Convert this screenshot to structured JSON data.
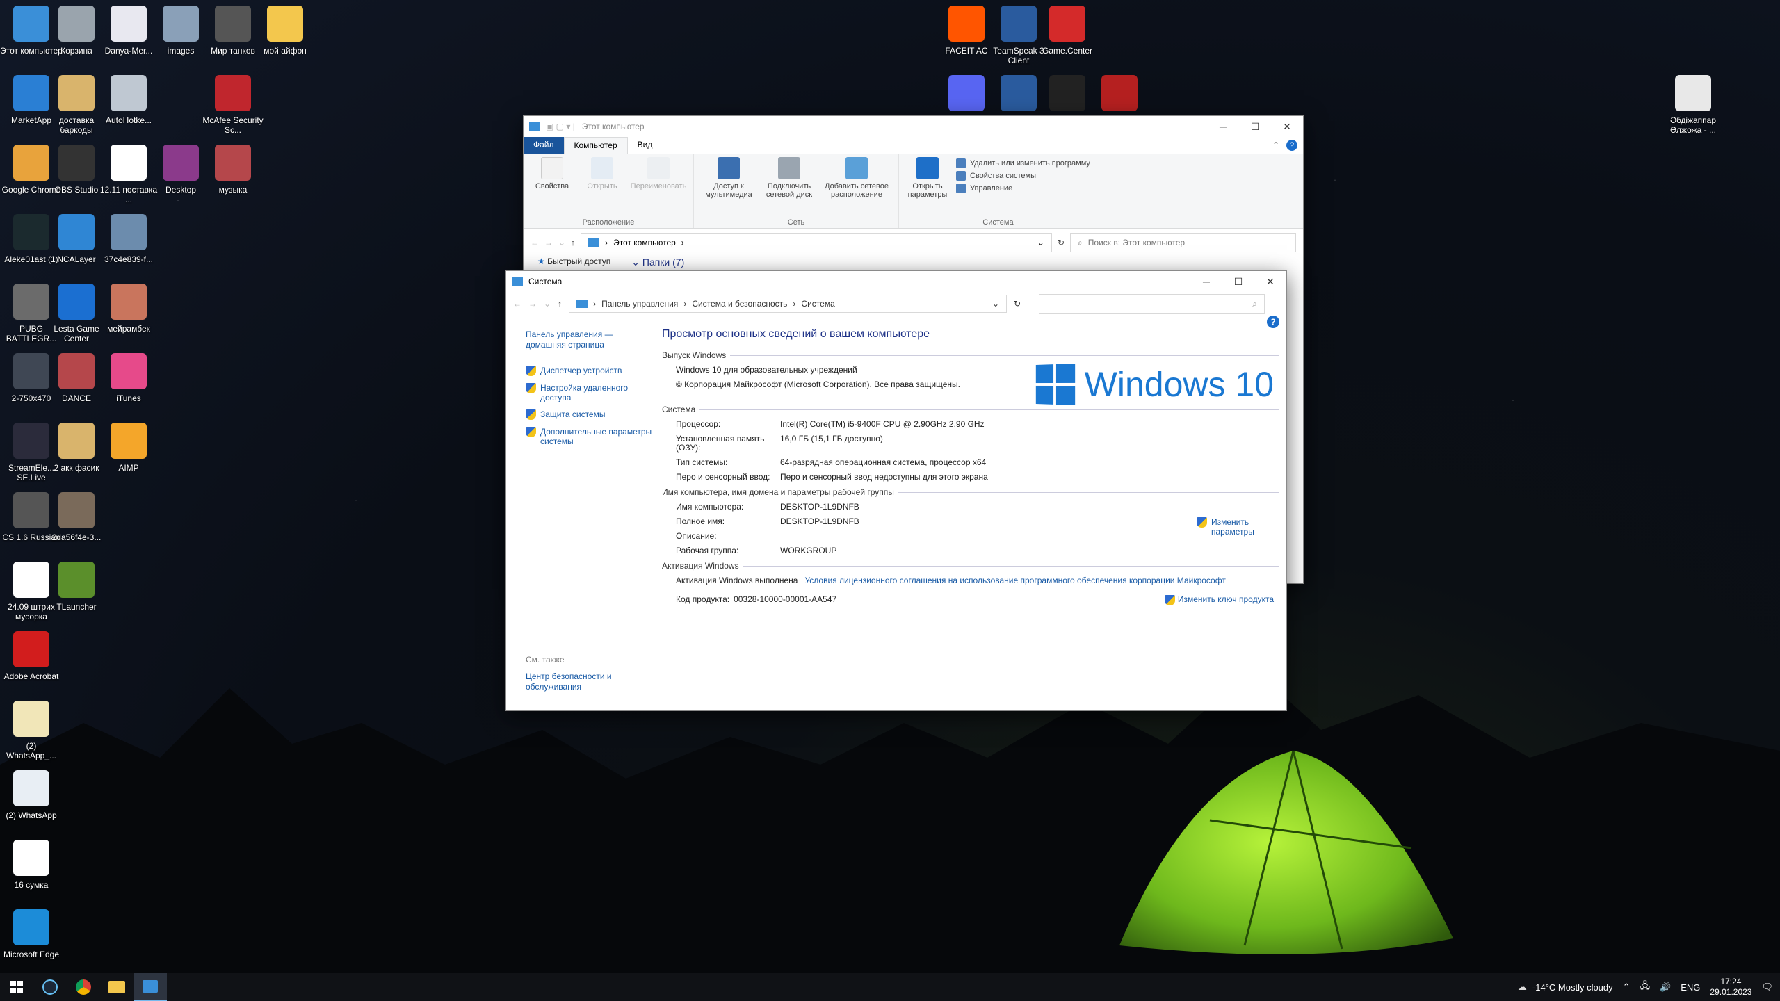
{
  "desktop_icons": [
    {
      "label": "Этот компьютер",
      "icon": "this-pc-icon",
      "color": "#3a8fd8"
    },
    {
      "label": "Корзина",
      "icon": "recycle-bin-icon",
      "color": "#9aa4ad"
    },
    {
      "label": "Danya-Mer...",
      "icon": "word-doc-icon",
      "color": "#e8e8f0"
    },
    {
      "label": "images",
      "icon": "image-icon",
      "color": "#8aa0b8"
    },
    {
      "label": "Мир танков",
      "icon": "tank-game-icon",
      "color": "#555"
    },
    {
      "label": "мой айфон",
      "icon": "folder-icon",
      "color": "#f3c74d"
    },
    {
      "label": "MarketApp",
      "icon": "marketapp-icon",
      "color": "#2a7fd4"
    },
    {
      "label": "доставка баркоды",
      "icon": "archive-icon",
      "color": "#d9b46c"
    },
    {
      "label": "AutoHotke...",
      "icon": "script-icon",
      "color": "#bfc8d2"
    },
    {
      "label": "McAfee Security Sc...",
      "icon": "mcafee-icon",
      "color": "#c0262d"
    },
    {
      "label": "Google Chrome",
      "icon": "chrome-icon",
      "color": "#e8a33c"
    },
    {
      "label": "OBS Studio",
      "icon": "obs-icon",
      "color": "#333"
    },
    {
      "label": "12.11 поставка ...",
      "icon": "pdf-icon",
      "color": "#fff"
    },
    {
      "label": "Desktop",
      "icon": "winrar-icon",
      "color": "#8b3a8b"
    },
    {
      "label": "музыка",
      "icon": "archive-icon",
      "color": "#b5474b"
    },
    {
      "label": "Aleke01ast (1)",
      "icon": "file-icon",
      "color": "#1b2a2e"
    },
    {
      "label": "NCALayer",
      "icon": "ncalayer-icon",
      "color": "#2f86d4"
    },
    {
      "label": "37c4e839-f...",
      "icon": "image-icon",
      "color": "#6c8cad"
    },
    {
      "label": "PUBG BATTLEGR...",
      "icon": "pubg-icon",
      "color": "#6b6b6b"
    },
    {
      "label": "Lesta Game Center",
      "icon": "lesta-icon",
      "color": "#1b6fd1"
    },
    {
      "label": "мейрамбек",
      "icon": "archive-icon",
      "color": "#c9755d"
    },
    {
      "label": "2-750x470",
      "icon": "image-icon",
      "color": "#3f4754"
    },
    {
      "label": "DANCE",
      "icon": "archive-icon",
      "color": "#b5474b"
    },
    {
      "label": "iTunes",
      "icon": "itunes-icon",
      "color": "#e64a8a"
    },
    {
      "label": "StreamEle... SE.Live",
      "icon": "streamelements-icon",
      "color": "#2b2b3b"
    },
    {
      "label": "2 акк фасик",
      "icon": "archive-icon",
      "color": "#d9b46c"
    },
    {
      "label": "AIMP",
      "icon": "aimp-icon",
      "color": "#f4a62a"
    },
    {
      "label": "CS 1.6 Russian",
      "icon": "cs-icon",
      "color": "#555"
    },
    {
      "label": "2da56f4e-3...",
      "icon": "image-icon",
      "color": "#7a6a5a"
    },
    {
      "label": "24.09 штрих мусорка",
      "icon": "pdf-icon",
      "color": "#fff"
    },
    {
      "label": "TLauncher",
      "icon": "tlauncher-icon",
      "color": "#5b8f2b"
    },
    {
      "label": "Adobe Acrobat",
      "icon": "acrobat-icon",
      "color": "#d21d1d"
    },
    {
      "label": "(2) WhatsApp_...",
      "icon": "document-icon",
      "color": "#f1e6b8"
    },
    {
      "label": "(2) WhatsApp",
      "icon": "document-icon",
      "color": "#e8eef4"
    },
    {
      "label": "16 сумка",
      "icon": "pdf-icon",
      "color": "#fff"
    },
    {
      "label": "Microsoft Edge",
      "icon": "edge-icon",
      "color": "#1c8cd8"
    },
    {
      "label": "FACEIT AC",
      "icon": "faceit-ac-icon",
      "color": "#ff5500"
    },
    {
      "label": "TeamSpeak 3 Client",
      "icon": "teamspeak-icon",
      "color": "#2a5b9e"
    },
    {
      "label": "Game.Center",
      "icon": "gamecenter-icon",
      "color": "#d42a2a"
    },
    {
      "label": "Discord",
      "icon": "discord-icon",
      "color": "#5865f2"
    },
    {
      "label": "TeamSpeak",
      "icon": "teamspeak-icon",
      "color": "#2a5b9e"
    },
    {
      "label": "FACEIT",
      "icon": "faceit-icon",
      "color": "#222"
    },
    {
      "label": "NEXTRP",
      "icon": "nextrp-icon",
      "color": "#b52020"
    },
    {
      "label": "Әбдіжаппар Әлжожа - ...",
      "icon": "music-file-icon",
      "color": "#e8e8e8"
    }
  ],
  "explorer": {
    "title": "Этот компьютер",
    "tabs": [
      "Файл",
      "Компьютер",
      "Вид"
    ],
    "ribbon": {
      "location_group": {
        "name": "Расположение",
        "items": [
          "Свойства",
          "Открыть",
          "Переименовать"
        ]
      },
      "network_group": {
        "name": "Сеть",
        "items": [
          "Доступ к мультимедиа",
          "Подключить сетевой диск",
          "Добавить сетевое расположение"
        ]
      },
      "system_group": {
        "name": "Система",
        "open_settings": "Открыть параметры",
        "items": [
          "Удалить или изменить программу",
          "Свойства системы",
          "Управление"
        ]
      }
    },
    "address": "Этот компьютер",
    "search_placeholder": "Поиск в: Этот компьютер",
    "quick_access": "Быстрый доступ",
    "folders_header": "Папки (7)"
  },
  "system": {
    "title": "Система",
    "breadcrumb": [
      "Панель управления",
      "Система и безопасность",
      "Система"
    ],
    "left_links": {
      "home": "Панель управления — домашняя страница",
      "items": [
        "Диспетчер устройств",
        "Настройка удаленного доступа",
        "Защита системы",
        "Дополнительные параметры системы"
      ],
      "see_also": "См. также",
      "security_center": "Центр безопасности и обслуживания"
    },
    "heading": "Просмотр основных сведений о вашем компьютере",
    "edition_section": "Выпуск Windows",
    "edition": "Windows 10 для образовательных учреждений",
    "copyright": "© Корпорация Майкрософт (Microsoft Corporation). Все права защищены.",
    "logo_text": "Windows 10",
    "system_section": "Система",
    "system_rows": [
      {
        "k": "Процессор:",
        "v": "Intel(R) Core(TM) i5-9400F CPU @ 2.90GHz   2.90 GHz"
      },
      {
        "k": "Установленная память (ОЗУ):",
        "v": "16,0 ГБ (15,1 ГБ доступно)"
      },
      {
        "k": "Тип системы:",
        "v": "64-разрядная операционная система, процессор x64"
      },
      {
        "k": "Перо и сенсорный ввод:",
        "v": "Перо и сенсорный ввод недоступны для этого экрана"
      }
    ],
    "name_section": "Имя компьютера, имя домена и параметры рабочей группы",
    "name_rows": [
      {
        "k": "Имя компьютера:",
        "v": "DESKTOP-1L9DNFB"
      },
      {
        "k": "Полное имя:",
        "v": "DESKTOP-1L9DNFB"
      },
      {
        "k": "Описание:",
        "v": ""
      },
      {
        "k": "Рабочая группа:",
        "v": "WORKGROUP"
      }
    ],
    "change_settings": "Изменить параметры",
    "activation_section": "Активация Windows",
    "activation_status": "Активация Windows выполнена",
    "license_link": "Условия лицензионного соглашения на использование программного обеспечения корпорации Майкрософт",
    "product_key_label": "Код продукта:",
    "product_key": "00328-10000-00001-AA547",
    "change_key": "Изменить ключ продукта"
  },
  "taskbar": {
    "weather": "-14°C  Mostly cloudy",
    "lang": "ENG",
    "time": "17:24",
    "date": "29.01.2023"
  }
}
